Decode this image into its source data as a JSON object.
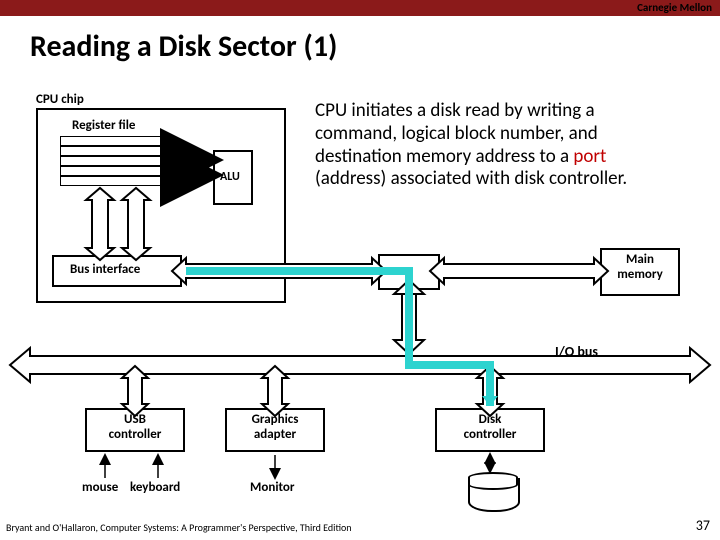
{
  "header": {
    "org": "Carnegie Mellon"
  },
  "title": "Reading a Disk Sector (1)",
  "cpu": {
    "label": "CPU chip",
    "regfile": "Register file",
    "alu": "ALU",
    "busif": "Bus interface"
  },
  "desc": {
    "text_pre": "CPU initiates a disk read by writing a command, logical block number, and destination memory address to a ",
    "port": "port",
    "text_post": " (address) associated with disk controller."
  },
  "mainmem": "Main\nmemory",
  "iobus": "I/O bus",
  "devices": {
    "usb": "USB\ncontroller",
    "gfx": "Graphics\nadapter",
    "disk": "Disk\ncontroller"
  },
  "peripherals": {
    "mouse": "mouse",
    "keyboard": "keyboard",
    "monitor": "Monitor",
    "disk": "Disk"
  },
  "footer": {
    "credit": "Bryant and O'Hallaron, Computer Systems: A Programmer's Perspective, Third Edition",
    "slidenum": "37"
  }
}
